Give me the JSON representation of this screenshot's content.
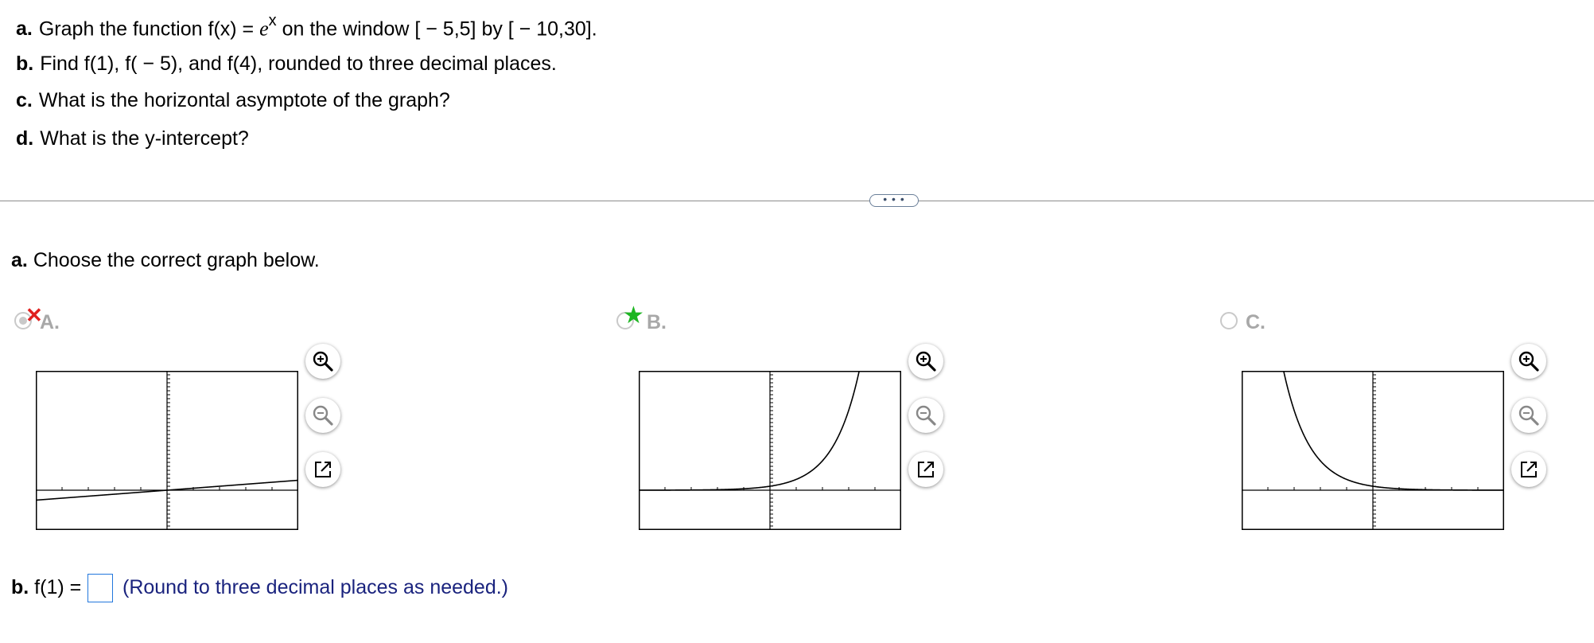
{
  "question": {
    "a": {
      "label": "a.",
      "pre": "Graph the function f(x) = ",
      "base": "e",
      "exp": "x",
      "post": " on the window [ − 5,5] by [ − 10,30]."
    },
    "b": {
      "label": "b.",
      "text": "Find f(1), f( − 5), and f(4), rounded to three decimal places."
    },
    "c": {
      "label": "c.",
      "text": "What is the horizontal asymptote of the graph?"
    },
    "d": {
      "label": "d.",
      "text": "What is the y-intercept?"
    }
  },
  "expand_button": {
    "label": "• • •"
  },
  "part_a": {
    "label": "a.",
    "prompt": "Choose the correct graph below."
  },
  "options": [
    {
      "letter": "A.",
      "selected": true,
      "mark": "incorrect-x-icon",
      "mark_glyph": "✕",
      "curve": "line"
    },
    {
      "letter": "B.",
      "selected": false,
      "mark": "correct-star-icon",
      "mark_glyph": "★",
      "curve": "exp_growth"
    },
    {
      "letter": "C.",
      "selected": false,
      "mark": "",
      "mark_glyph": "",
      "curve": "exp_decay"
    }
  ],
  "tools": {
    "zoom_in": "zoom-in-icon",
    "zoom_out": "zoom-out-icon",
    "popout": "popout-icon"
  },
  "part_b": {
    "label": "b.",
    "lhs": "f(1) =",
    "value": "",
    "hint": "(Round to three decimal places as needed.)"
  },
  "colors": {
    "mark_x": "#e0201f",
    "mark_star": "#1db522",
    "hint": "#1a237e",
    "input_border": "#2277dd"
  }
}
